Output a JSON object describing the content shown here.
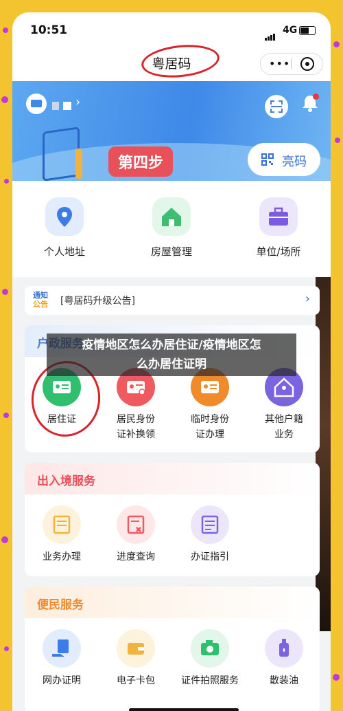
{
  "status_bar": {
    "time": "10:51",
    "network": "4G"
  },
  "nav": {
    "title": "粤居码",
    "more": "•••"
  },
  "banner": {
    "step_badge": "第四步",
    "bright_button": "亮码",
    "scan_icon": "scan-icon",
    "bell_icon": "bell-icon"
  },
  "quick_actions": [
    {
      "label": "个人地址",
      "icon": "location-pin-icon",
      "color": "#3d7be8"
    },
    {
      "label": "房屋管理",
      "icon": "house-icon",
      "color": "#3fbe72"
    },
    {
      "label": "单位/场所",
      "icon": "briefcase-icon",
      "color": "#7a5ce0"
    }
  ],
  "notice": {
    "tag_top": "通知",
    "tag_bottom": "公告",
    "text": "[粤居码升级公告]"
  },
  "household": {
    "title": "户政服务",
    "items": [
      {
        "label": "居住证",
        "icon": "id-card-icon",
        "color": "#2fbf6f"
      },
      {
        "label": "居民身份证补换领",
        "icon": "id-badge-icon",
        "color": "#ee5a5f"
      },
      {
        "label": "临时身份证办理",
        "icon": "temp-id-icon",
        "color": "#f08a2a"
      },
      {
        "label": "其他户籍业务",
        "icon": "home-person-icon",
        "color": "#7b64e0"
      }
    ]
  },
  "entry_exit": {
    "title": "出入境服务",
    "items": [
      {
        "label": "业务办理",
        "icon": "inbox-icon",
        "color": "#f0b340"
      },
      {
        "label": "进度查询",
        "icon": "doc-x-icon",
        "color": "#ee5a5f"
      },
      {
        "label": "办证指引",
        "icon": "doc-list-icon",
        "color": "#7b64e0"
      }
    ]
  },
  "convenience": {
    "title": "便民服务",
    "items": [
      {
        "label": "网办证明",
        "icon": "hand-doc-icon",
        "color": "#3d7be8"
      },
      {
        "label": "电子卡包",
        "icon": "wallet-icon",
        "color": "#f0b340"
      },
      {
        "label": "证件拍照服务",
        "icon": "camera-icon",
        "color": "#2fbf6f"
      },
      {
        "label": "散装油",
        "icon": "oil-bottle-icon",
        "color": "#7b64e0"
      }
    ]
  },
  "overlay_caption": {
    "line1": "疫情地区怎么办居住证/疫情地区怎",
    "line2": "么办居住证明"
  }
}
